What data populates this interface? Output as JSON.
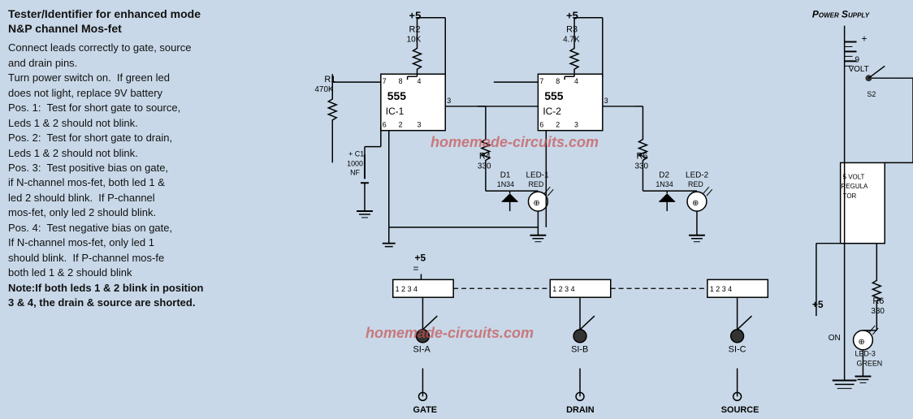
{
  "title_line1": "Tester/Identifier for enhanced mode",
  "title_line2": "N&P channel Mos-fet",
  "instructions": [
    "Connect leads correctly to gate, source",
    "and drain pins.",
    "Turn power switch on.  If green led",
    "does not light, replace 9V battery",
    "Pos. 1:  Test for short gate to source,",
    "Leds 1 & 2 should not blink.",
    "Pos. 2:  Test for short gate to drain,",
    "Leds 1 & 2 should not blink.",
    "Pos. 3:  Test positive bias on gate,",
    "if N-channel mos-fet, both led 1 &",
    "led 2 should blink.  If P-channel",
    "mos-fet, only led 2 should blink.",
    "Pos. 4:  Test negative bias on gate,",
    "If N-channel mos-fet, only led 1",
    "should blink.  If P-channel mos-fe",
    "both led 1 & 2 should blink",
    "Note:If both leds 1 & 2 blink in position",
    "3 & 4, the drain & source are shorted."
  ],
  "watermark1": "homemade-circuits.com",
  "watermark2": "homemade-circuits.com",
  "power_supply_label": "Power Supply",
  "labels": {
    "r1": "R1",
    "r1_val": "470K",
    "r2": "R2",
    "r2_val": "10K",
    "r3": "R3",
    "r3_val": "4.7K",
    "r4": "R4",
    "r4_val": "330",
    "r5": "R5",
    "r5_val": "330",
    "r6": "R6",
    "r6_val": "330",
    "c1": "+ C1",
    "c1_val": "1000 NF",
    "ic1": "555\nIC-1",
    "ic2": "555\nIC-2",
    "d1": "D1\nIN34",
    "d2": "D2\nIN34",
    "led1": "LED-1\nRED",
    "led2": "LED-2\nRED",
    "led3": "LED-3\nGREEN",
    "s1a": "SI-A",
    "s1b": "SI-B",
    "s1c": "SI-C",
    "gate": "GATE",
    "drain": "DRAIN",
    "source": "SOURCE",
    "plus5_1": "+5",
    "plus5_2": "+5",
    "plus5_3": "+5",
    "plus9": "9 VOLT",
    "plus5_ps": "+5",
    "reg": "5 VOLT\nREGULATOR",
    "on": "ON"
  }
}
